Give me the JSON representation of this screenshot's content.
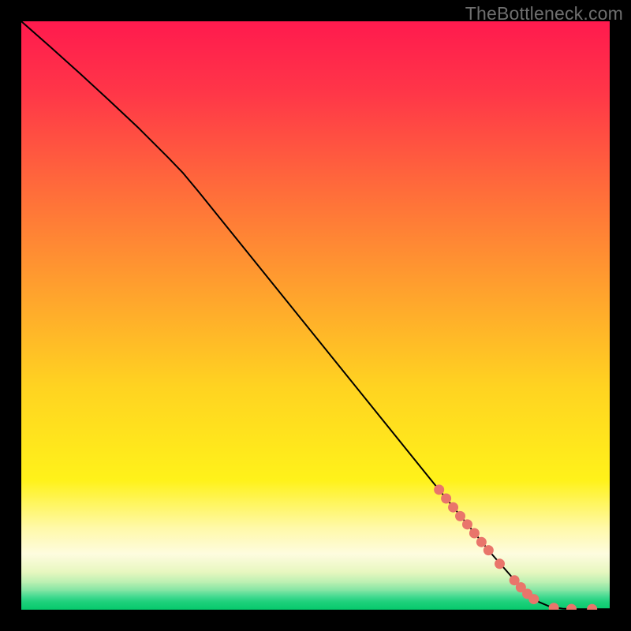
{
  "watermark": "TheBottleneck.com",
  "colors": {
    "line": "#000000",
    "dot_fill": "#e9756b",
    "dot_stroke": "#e9756b",
    "black": "#000000"
  },
  "chart_data": {
    "type": "line",
    "title": "",
    "xlabel": "",
    "ylabel": "",
    "xlim": [
      0,
      100
    ],
    "ylim": [
      0,
      100
    ],
    "grid": false,
    "legend": false,
    "gradient_stops": [
      {
        "pos": 0.0,
        "color": "#ff1a4e"
      },
      {
        "pos": 0.12,
        "color": "#ff3648"
      },
      {
        "pos": 0.28,
        "color": "#ff6a3b"
      },
      {
        "pos": 0.45,
        "color": "#ff9f2e"
      },
      {
        "pos": 0.62,
        "color": "#ffd321"
      },
      {
        "pos": 0.78,
        "color": "#fff21a"
      },
      {
        "pos": 0.86,
        "color": "#fff9a8"
      },
      {
        "pos": 0.905,
        "color": "#fefce0"
      },
      {
        "pos": 0.935,
        "color": "#e8f7c0"
      },
      {
        "pos": 0.955,
        "color": "#b5efb0"
      },
      {
        "pos": 0.968,
        "color": "#7ce4a2"
      },
      {
        "pos": 0.978,
        "color": "#3fd98f"
      },
      {
        "pos": 0.986,
        "color": "#1ed07b"
      },
      {
        "pos": 1.0,
        "color": "#06c96c"
      }
    ],
    "series": [
      {
        "name": "curve",
        "type": "line",
        "x": [
          0,
          5,
          10,
          15,
          20,
          25,
          27.5,
          30,
          35,
          40,
          45,
          50,
          55,
          60,
          65,
          70,
          75,
          80,
          85,
          88,
          90,
          92,
          93.5,
          95,
          97,
          98.5,
          100
        ],
        "y": [
          100,
          95.6,
          91.1,
          86.5,
          81.8,
          76.8,
          74.2,
          71.2,
          65.0,
          58.8,
          52.6,
          46.4,
          40.2,
          34.0,
          27.8,
          21.6,
          15.5,
          9.4,
          3.7,
          1.3,
          0.45,
          0.18,
          0.12,
          0.1,
          0.1,
          0.1,
          0.1
        ]
      },
      {
        "name": "highlight-dots",
        "type": "scatter",
        "r": 6,
        "points": [
          {
            "x": 71.0,
            "y": 20.4
          },
          {
            "x": 72.2,
            "y": 18.9
          },
          {
            "x": 73.4,
            "y": 17.4
          },
          {
            "x": 74.6,
            "y": 15.9
          },
          {
            "x": 75.8,
            "y": 14.5
          },
          {
            "x": 77.0,
            "y": 13.0
          },
          {
            "x": 78.2,
            "y": 11.5
          },
          {
            "x": 79.4,
            "y": 10.1
          },
          {
            "x": 81.3,
            "y": 7.8
          },
          {
            "x": 83.8,
            "y": 5.0
          },
          {
            "x": 84.9,
            "y": 3.8
          },
          {
            "x": 86.0,
            "y": 2.7
          },
          {
            "x": 87.1,
            "y": 1.8
          },
          {
            "x": 90.5,
            "y": 0.3
          },
          {
            "x": 93.5,
            "y": 0.12
          },
          {
            "x": 97.0,
            "y": 0.1
          }
        ]
      }
    ]
  }
}
